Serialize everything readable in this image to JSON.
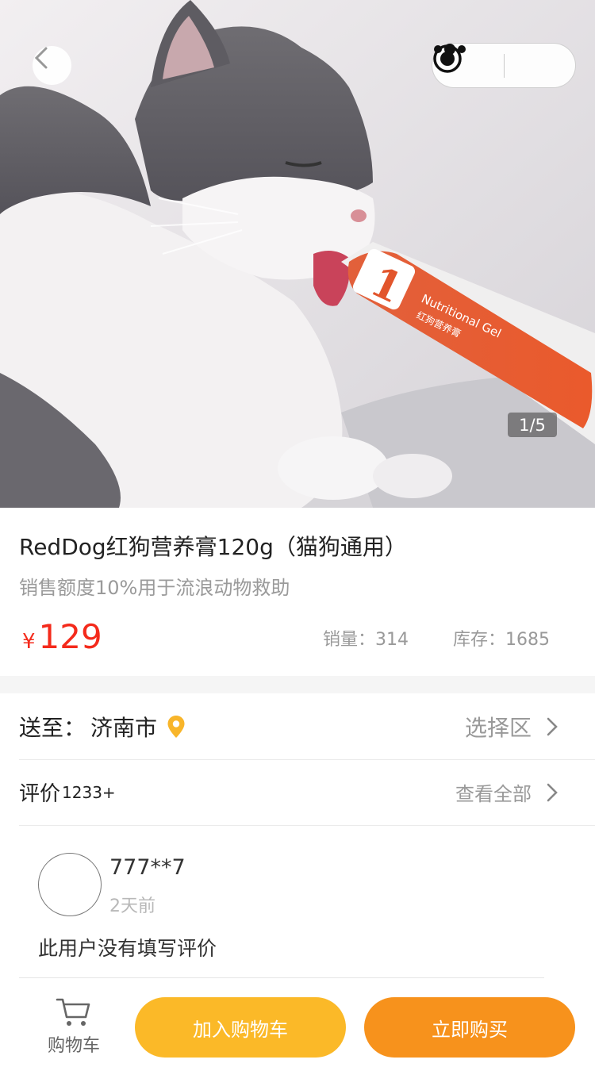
{
  "nav": {
    "back_icon": "chevron-left-icon",
    "more_icon": "more-dots-icon",
    "close_icon": "target-close-icon"
  },
  "gallery": {
    "counter": "1/5",
    "label_number": "1",
    "label_text": "Nutritional Gel",
    "label_text_cn": "红狗营养膏"
  },
  "product": {
    "title": "RedDog红狗营养膏120g（猫狗通用）",
    "subtitle": "销售额度10%用于流浪动物救助",
    "currency": "¥",
    "price": "129",
    "sales": "销量：314",
    "stock": "库存：1685",
    "price_color": "#f42a1b"
  },
  "shipping": {
    "label": "送至：",
    "city": "济南市",
    "select_label": "选择区",
    "location_icon": "location-pin-icon",
    "accent": "#f8b52a"
  },
  "reviews": {
    "label": "评价",
    "count": "1233+",
    "view_all": "查看全部",
    "items": [
      {
        "user": "777**7",
        "time": "2天前",
        "text": "此用户没有填写评价"
      }
    ]
  },
  "bottom_bar": {
    "cart_label": "购物车",
    "cart_icon": "shopping-cart-icon",
    "add_to_cart": "加入购物车",
    "buy_now": "立即购买",
    "add_color": "#fbb928",
    "buy_color": "#f7921c"
  }
}
